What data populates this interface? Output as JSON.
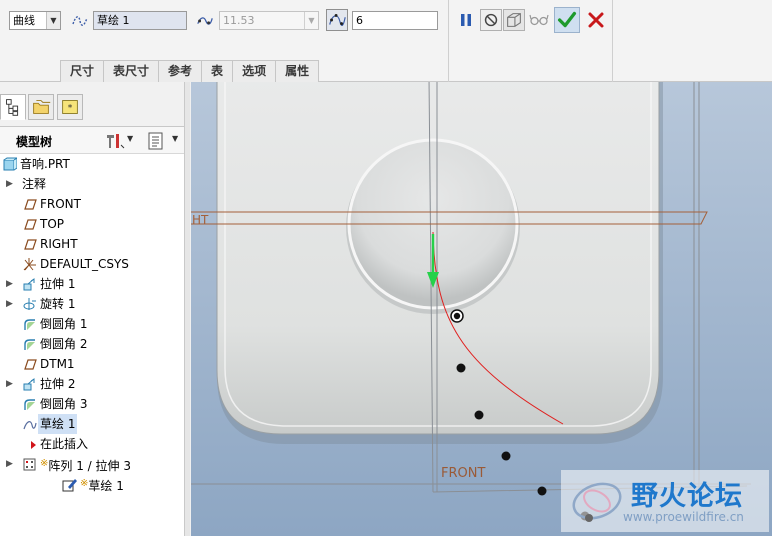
{
  "dashboard": {
    "type_dropdown": {
      "value": "曲线"
    },
    "sketch_field": {
      "value": "草绘 1"
    },
    "length_field": {
      "value": "11.53"
    },
    "points_field": {
      "value": "6"
    },
    "tabs": [
      {
        "label": "尺寸"
      },
      {
        "label": "表尺寸"
      },
      {
        "label": "参考"
      },
      {
        "label": "表"
      },
      {
        "label": "选项"
      },
      {
        "label": "属性"
      }
    ],
    "icons": {
      "curve_type": "curve-icon",
      "length_ratio": "length-ratio-icon",
      "point_pattern": "point-pattern-icon",
      "pause": "pause-icon",
      "stop": "stop-icon",
      "preview_box": "preview-box-icon",
      "glasses": "glasses-icon",
      "ok": "checkmark-icon",
      "cancel": "close-icon"
    },
    "colors": {
      "ok_green": "#1e9a2c",
      "cancel_red": "#c8181b",
      "pause_blue": "#2b5bb0"
    }
  },
  "left_panel": {
    "tree_header": {
      "title": "模型树"
    },
    "tree_items": [
      {
        "label": "音响.PRT",
        "icon": "part-icon",
        "expandable": false
      },
      {
        "label": "注释",
        "icon": "",
        "expandable": true
      },
      {
        "label": "FRONT",
        "icon": "datum-plane-icon",
        "expandable": false
      },
      {
        "label": "TOP",
        "icon": "datum-plane-icon",
        "expandable": false
      },
      {
        "label": "RIGHT",
        "icon": "datum-plane-icon",
        "expandable": false
      },
      {
        "label": "DEFAULT_CSYS",
        "icon": "csys-icon",
        "expandable": false
      },
      {
        "label": "拉伸 1",
        "icon": "extrude-icon",
        "expandable": true
      },
      {
        "label": "旋转 1",
        "icon": "revolve-icon",
        "expandable": true
      },
      {
        "label": "倒圆角 1",
        "icon": "round-icon",
        "expandable": false
      },
      {
        "label": "倒圆角 2",
        "icon": "round-icon",
        "expandable": false
      },
      {
        "label": "DTM1",
        "icon": "datum-plane-icon",
        "expandable": false
      },
      {
        "label": "拉伸 2",
        "icon": "extrude-icon",
        "expandable": true
      },
      {
        "label": "倒圆角 3",
        "icon": "round-icon",
        "expandable": false
      },
      {
        "label": "草绘 1",
        "icon": "sketch-icon",
        "expandable": false,
        "highlighted": true
      },
      {
        "label": "在此插入",
        "icon": "insert-arrow-icon",
        "expandable": false
      },
      {
        "label": "阵列 1 / 拉伸 3",
        "icon": "pattern-icon",
        "expandable": true,
        "starred": true
      },
      {
        "label": "草绘 1",
        "icon": "sketch-pencil-icon",
        "expandable": false,
        "starred": true,
        "indent": true
      }
    ]
  },
  "viewport": {
    "plane_labels": {
      "right": "HT",
      "front": "FRONT"
    },
    "colors": {
      "background_top": "#b5c5d9",
      "background_bottom": "#8ea6c2",
      "body": "#e2e4e3",
      "curve": "#e0201f",
      "direction_arrow": "#26d14a",
      "datum": "#a4603a"
    }
  },
  "watermark": {
    "title": "野火论坛",
    "url": "www.proewildfire.cn"
  }
}
